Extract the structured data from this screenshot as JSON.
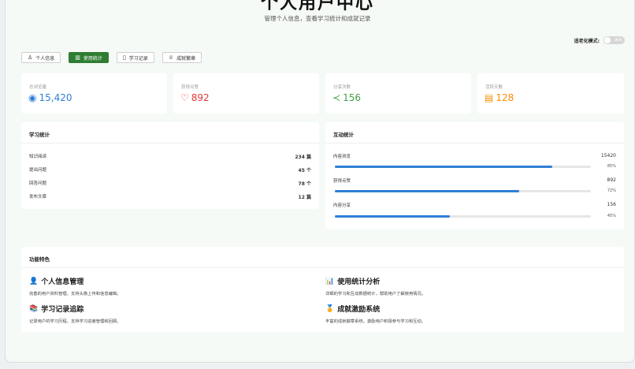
{
  "header": {
    "title": "个人用户中心",
    "subtitle": "管理个人信息，查看学习统计和成就记录"
  },
  "elder_mode": {
    "label": "适老化模式:",
    "toggle_text": "关闭",
    "enabled": false
  },
  "tabs": [
    {
      "label": "个人信息",
      "icon": "user-icon",
      "glyph": "♙",
      "active": false
    },
    {
      "label": "使用统计",
      "icon": "chart-icon",
      "glyph": "▥",
      "active": true
    },
    {
      "label": "学习记录",
      "icon": "book-icon",
      "glyph": "▯",
      "active": false
    },
    {
      "label": "成就徽章",
      "icon": "trophy-icon",
      "glyph": "♕",
      "active": false
    }
  ],
  "stats": [
    {
      "label": "总浏览量",
      "value": "15,420",
      "icon": "eye-icon",
      "glyph": "◉",
      "color": "#2f7fd6"
    },
    {
      "label": "获得点赞",
      "value": "892",
      "icon": "heart-icon",
      "glyph": "♡",
      "color": "#e53935"
    },
    {
      "label": "分享次数",
      "value": "156",
      "icon": "share-icon",
      "glyph": "≺",
      "color": "#43a047"
    },
    {
      "label": "活跃天数",
      "value": "128",
      "icon": "calendar-icon",
      "glyph": "▤",
      "color": "#fb8c00"
    }
  ],
  "learning": {
    "title": "学习统计",
    "rows": [
      {
        "label": "知识阅读",
        "value": "234 篇"
      },
      {
        "label": "提出问题",
        "value": "45 个"
      },
      {
        "label": "回答问题",
        "value": "78 个"
      },
      {
        "label": "发布文章",
        "value": "12 篇"
      }
    ]
  },
  "interaction": {
    "title": "互动统计",
    "rows": [
      {
        "label": "内容浏览",
        "value": "15420",
        "percent": "85%",
        "fraction": 0.85
      },
      {
        "label": "获得点赞",
        "value": "892",
        "percent": "72%",
        "fraction": 0.72
      },
      {
        "label": "内容分享",
        "value": "156",
        "percent": "45%",
        "fraction": 0.45
      }
    ]
  },
  "features": {
    "title": "功能特色",
    "items": [
      {
        "title": "个人信息管理",
        "desc": "完善的用户资料管理，支持头像上传和信息编辑。",
        "icon": "person-icon",
        "glyph": "👤"
      },
      {
        "title": "使用统计分析",
        "desc": "详细的学习和互动数据统计，帮助用户了解使用情况。",
        "icon": "bar-chart-icon",
        "glyph": "📊"
      },
      {
        "title": "学习记录追踪",
        "desc": "记录用户的学习历程，支持学习进度管理和回顾。",
        "icon": "books-icon",
        "glyph": "📚"
      },
      {
        "title": "成就激励系统",
        "desc": "丰富的成就徽章系统，激励用户积极参与学习和互动。",
        "icon": "medal-icon",
        "glyph": "🏅"
      }
    ]
  }
}
